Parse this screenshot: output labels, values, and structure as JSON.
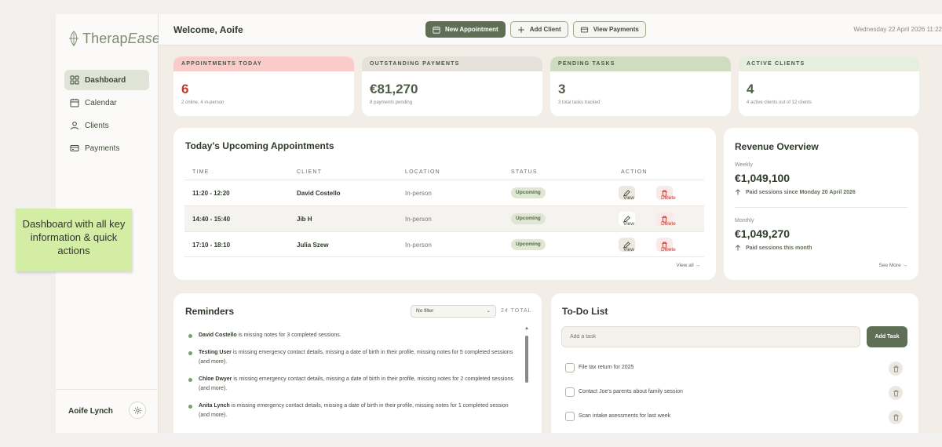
{
  "app": {
    "logo_prefix": "Therap",
    "logo_suffix": "Ease"
  },
  "sidebar": {
    "items": [
      {
        "label": "Dashboard",
        "icon": "grid-icon"
      },
      {
        "label": "Calendar",
        "icon": "calendar-icon"
      },
      {
        "label": "Clients",
        "icon": "user-icon"
      },
      {
        "label": "Payments",
        "icon": "card-icon"
      }
    ],
    "active": "Dashboard",
    "user_name": "Aoife Lynch"
  },
  "header": {
    "welcome": "Welcome, Aoife",
    "new_appointment": "New Appointment",
    "add_client": "Add Client",
    "view_payments": "View Payments",
    "date": "Wednesday 22 April 2026 11:22"
  },
  "stats": [
    {
      "title": "APPOINTMENTS TODAY",
      "value": "6",
      "sub": "2 online, 4 in-person",
      "head_color": "#f9cbcb",
      "value_color": "#c0392b"
    },
    {
      "title": "OUTSTANDING PAYMENTS",
      "value": "€81,270",
      "sub": "8 payments pending",
      "head_color": "#e6e1da",
      "value_color": "#4e5d47"
    },
    {
      "title": "PENDING TASKS",
      "value": "3",
      "sub": "3 total tasks tracked",
      "head_color": "#cfdcc0",
      "value_color": "#4e5d47"
    },
    {
      "title": "ACTIVE CLIENTS",
      "value": "4",
      "sub": "4 active clients out of 12 clients",
      "head_color": "#e6eedf",
      "value_color": "#4e5d47"
    }
  ],
  "appointments": {
    "title": "Today's Upcoming Appointments",
    "columns": [
      "TIME",
      "CLIENT",
      "LOCATION",
      "STATUS",
      "ACTION"
    ],
    "rows": [
      {
        "time": "11:20 - 12:20",
        "client": "David Costello",
        "location": "In-person",
        "status": "Upcoming"
      },
      {
        "time": "14:40 - 15:40",
        "client": "Jib H",
        "location": "In-person",
        "status": "Upcoming"
      },
      {
        "time": "17:10 - 18:10",
        "client": "Julia Szew",
        "location": "In-person",
        "status": "Upcoming"
      }
    ],
    "view_label": "View",
    "delete_label": "Delete",
    "view_all": "View all →"
  },
  "revenue": {
    "title": "Revenue Overview",
    "weekly_label": "Weekly",
    "weekly_value": "€1,049,100",
    "weekly_note": "Paid sessions since Monday 20 April 2026",
    "monthly_label": "Monthly",
    "monthly_value": "€1,049,270",
    "monthly_note": "Paid sessions this month",
    "see_more": "See More →"
  },
  "reminders": {
    "title": "Reminders",
    "filter": "No filter",
    "total": "24 TOTAL",
    "items": [
      {
        "name": "David Costello",
        "text": " is missing notes for 3 completed sessions."
      },
      {
        "name": "Testing User",
        "text": " is missing emergency contact details, missing a date of birth in their profile, missing notes for 5 completed sessions (and more)."
      },
      {
        "name": "Chloe Dwyer",
        "text": " is missing emergency contact details, missing a date of birth in their profile, missing notes for 2 completed sessions (and more)."
      },
      {
        "name": "Anita Lynch",
        "text": " is missing emergency contact details, missing a date of birth in their profile, missing notes for 1 completed session (and more)."
      }
    ]
  },
  "todo": {
    "title": "To-Do List",
    "placeholder": "Add a task",
    "add_label": "Add Task",
    "items": [
      "File tax return for 2025",
      "Contact Joe's parents about family session",
      "Scan intake asessments for last week"
    ]
  },
  "annotation": "Dashboard with all key information & quick actions"
}
